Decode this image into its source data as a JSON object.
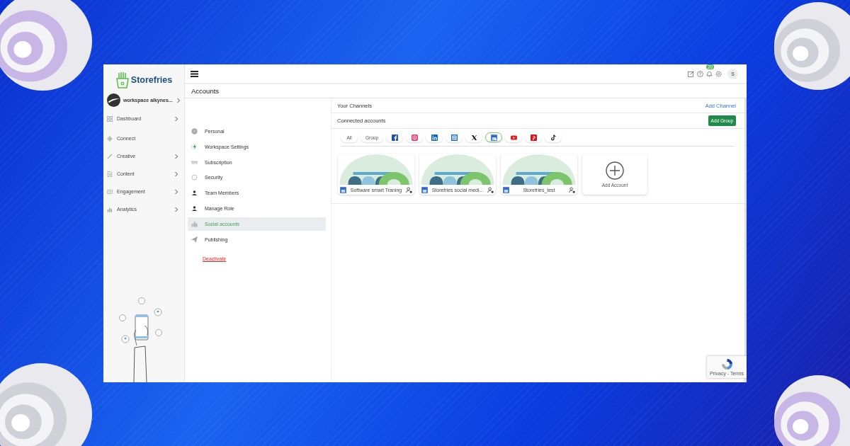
{
  "sidebar": {
    "brand": "Storefries",
    "workspace": "workspace alkynes...",
    "items": [
      {
        "label": "Dashboard",
        "kind": "dashboard",
        "has_submenu": true
      },
      {
        "label": "Connect",
        "kind": "connect",
        "has_submenu": false
      },
      {
        "label": "Creative",
        "kind": "creative",
        "has_submenu": true
      },
      {
        "label": "Content",
        "kind": "content",
        "has_submenu": true
      },
      {
        "label": "Engagement",
        "kind": "engagement",
        "has_submenu": true
      },
      {
        "label": "Analytics",
        "kind": "analytics",
        "has_submenu": true
      }
    ]
  },
  "header": {
    "title": "Accounts",
    "notification_count": "20",
    "avatar_initial": "S"
  },
  "settings_menu": {
    "items": [
      {
        "label": "Personal",
        "kind": "personal",
        "selected": false
      },
      {
        "label": "Workspace Settings",
        "kind": "workspace",
        "selected": false
      },
      {
        "label": "Subscription",
        "kind": "subscription",
        "selected": false
      },
      {
        "label": "Security",
        "kind": "security",
        "selected": false
      },
      {
        "label": "Team Members",
        "kind": "team",
        "selected": false
      },
      {
        "label": "Manage Role",
        "kind": "team",
        "selected": false
      },
      {
        "label": "Social accounts",
        "kind": "social",
        "selected": true
      },
      {
        "label": "Publishing",
        "kind": "publishing",
        "selected": false
      }
    ],
    "deactivate": "Deactivate"
  },
  "channels": {
    "title": "Your Channels",
    "add_channel": "Add Channel",
    "connected_title": "Connected accounts",
    "add_group": "Add Group",
    "filters": [
      {
        "kind": "text",
        "label": "All",
        "selected": false
      },
      {
        "kind": "text",
        "label": "Group",
        "selected": false
      },
      {
        "kind": "facebook",
        "selected": false
      },
      {
        "kind": "instagram",
        "selected": false
      },
      {
        "kind": "linkedin",
        "selected": false
      },
      {
        "kind": "linkedin_page",
        "selected": false
      },
      {
        "kind": "x",
        "selected": false
      },
      {
        "kind": "business",
        "selected": true
      },
      {
        "kind": "youtube",
        "selected": false
      },
      {
        "kind": "pinterest",
        "selected": false
      },
      {
        "kind": "tiktok",
        "selected": false
      }
    ],
    "accounts": [
      {
        "name": "Software smart Traning"
      },
      {
        "name": "Storefries social medi..."
      },
      {
        "name": "Storefries_test"
      }
    ],
    "add_account": "Add Account"
  },
  "recaptcha": {
    "text": "Privacy - Terms"
  }
}
